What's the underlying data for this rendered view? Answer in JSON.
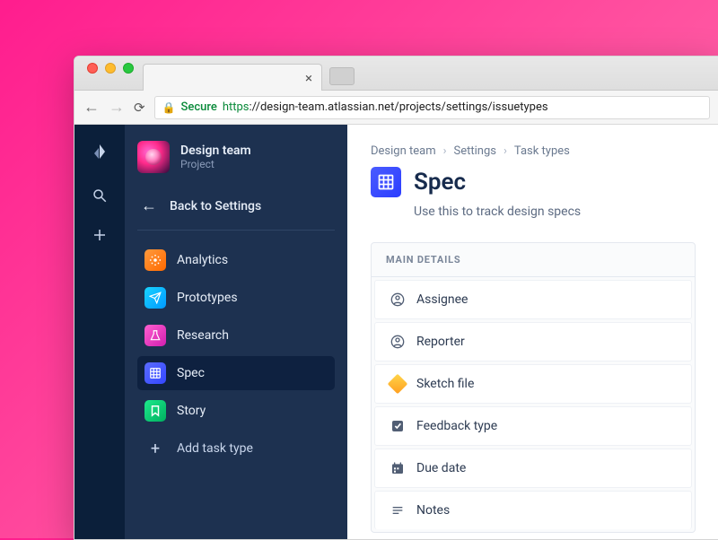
{
  "browser": {
    "secure_label": "Secure",
    "url_protocol": "https",
    "url_rest": "://design-team.atlassian.net/projects/settings/issuetypes"
  },
  "sidebar": {
    "project_name": "Design team",
    "project_subtitle": "Project",
    "back_label": "Back to Settings",
    "types": [
      {
        "label": "Analytics"
      },
      {
        "label": "Prototypes"
      },
      {
        "label": "Research"
      },
      {
        "label": "Spec"
      },
      {
        "label": "Story"
      }
    ],
    "add_type_label": "Add task type"
  },
  "main": {
    "breadcrumbs": [
      "Design team",
      "Settings",
      "Task types"
    ],
    "title": "Spec",
    "subtitle": "Use this to track design specs",
    "panel_header": "MAIN DETAILS",
    "fields": [
      {
        "label": "Assignee"
      },
      {
        "label": "Reporter"
      },
      {
        "label": "Sketch file"
      },
      {
        "label": "Feedback type"
      },
      {
        "label": "Due date"
      },
      {
        "label": "Notes"
      }
    ]
  }
}
